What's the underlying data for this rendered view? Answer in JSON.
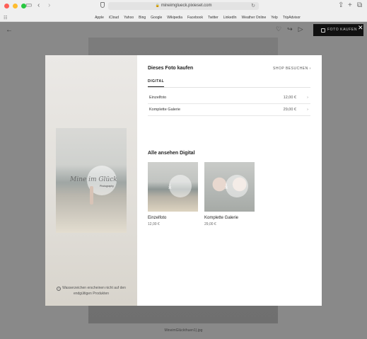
{
  "browser": {
    "url": "mineimglueck.pixieset.com",
    "bookmarks": [
      "Apple",
      "iCloud",
      "Yahoo",
      "Bing",
      "Google",
      "Wikipedia",
      "Facebook",
      "Twitter",
      "LinkedIn",
      "Weather Online",
      "Yelp",
      "TripAdvisor"
    ]
  },
  "page": {
    "buy_button": "FOTO KAUFEN",
    "filename": "MineimGlückthuen1).jpg"
  },
  "modal": {
    "title": "Dieses Foto kaufen",
    "shop_link": "SHOP BESUCHEN",
    "tab": "DIGITAL",
    "rows": [
      {
        "label": "Einzelfoto",
        "price": "12,00 €"
      },
      {
        "label": "Komplette Galerie",
        "price": "29,00 €"
      }
    ],
    "section_title": "Alle ansehen Digital",
    "cards": [
      {
        "name": "Einzelfoto",
        "price": "12,00 €"
      },
      {
        "name": "Komplette Galerie",
        "price": "29,00 €"
      }
    ],
    "watermark_note": "Wasserzeichen erscheinen nicht auf den endgültigen Produkten",
    "watermark_text": "Mine im Glück",
    "watermark_sub": "Photography"
  }
}
